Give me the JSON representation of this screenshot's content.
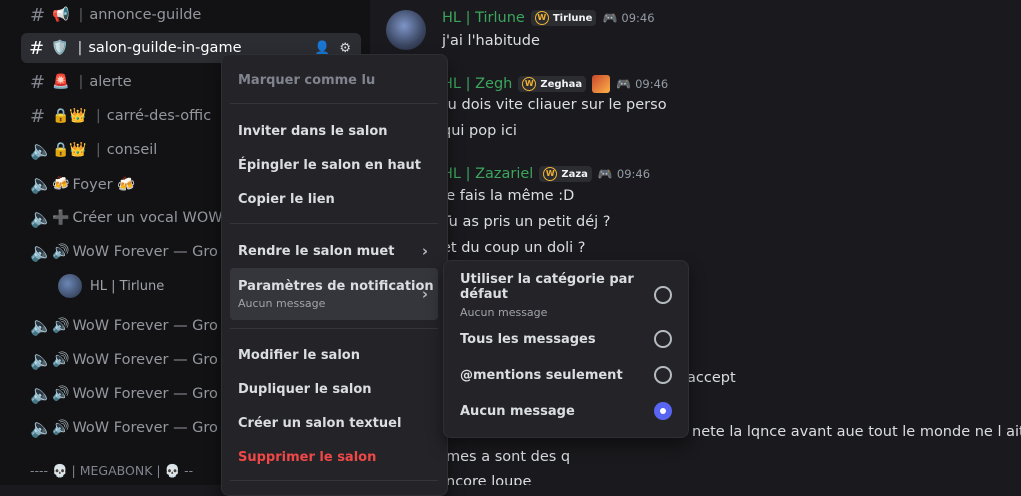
{
  "sidebar": {
    "channels": [
      {
        "type": "text",
        "emoji": "📢",
        "name": "annonce-guilde"
      },
      {
        "type": "text",
        "emoji": "🛡️",
        "name": "salon-guilde-in-game",
        "active": true
      },
      {
        "type": "text",
        "emoji": "🚨",
        "name": "alerte"
      },
      {
        "type": "text",
        "emoji": "🔒👑",
        "name": "carré-des-offic"
      },
      {
        "type": "voice",
        "emoji": "🔒👑",
        "name": "conseil"
      },
      {
        "type": "voice",
        "emoji": "🍻",
        "name": "Foyer 🍻"
      },
      {
        "type": "voice",
        "emoji": "➕",
        "name": "Créer un vocal WOW"
      },
      {
        "type": "voice",
        "emoji": "🔊",
        "name": "WoW Forever — Gro"
      },
      {
        "type": "voice",
        "emoji": "🔊",
        "name": "WoW Forever — Gro"
      },
      {
        "type": "voice",
        "emoji": "🔊",
        "name": "WoW Forever — Gro"
      },
      {
        "type": "voice",
        "emoji": "🔊",
        "name": "WoW Forever — Gro"
      },
      {
        "type": "voice",
        "emoji": "🔊",
        "name": "WoW Forever — Gro"
      }
    ],
    "voice_user": "HL | Tirlune",
    "bottom_label": "---- 💀 | MEGABONK | 💀 --"
  },
  "chat": {
    "messages": [
      {
        "user": "HL | Tirlune",
        "tag": "Tirlune",
        "time": "09:46",
        "lines": [
          "j'ai l'habitude"
        ]
      },
      {
        "user": "HL | Zegh",
        "tag": "Zeghaa",
        "time": "09:46",
        "lines": [
          "tu dois vite cliauer sur le perso",
          "qui pop ici"
        ]
      },
      {
        "user": "HL | Zazariel",
        "tag": "Zaza",
        "time": "09:46",
        "lines": [
          "Je fais la même :D",
          "Tu as pris un petit déj ?",
          "et du coup un doli ?"
        ]
      }
    ],
    "partial_lines": [
      "accept",
      "nete la lqnce avant aue tout le monde ne l ait pris",
      "mes a sont des q",
      "ncore loupe"
    ]
  },
  "context_menu": {
    "mark_read": "Marquer comme lu",
    "invite": "Inviter dans le salon",
    "pin": "Épingler le salon en haut",
    "copy_link": "Copier le lien",
    "mute": "Rendre le salon muet",
    "notif_settings": "Paramètres de notification",
    "notif_current": "Aucun message",
    "edit": "Modifier le salon",
    "duplicate": "Dupliquer le salon",
    "create_text": "Créer un salon textuel",
    "delete": "Supprimer le salon"
  },
  "notification_submenu": {
    "options": [
      {
        "label": "Utiliser la catégorie par défaut",
        "sub": "Aucun message",
        "selected": false
      },
      {
        "label": "Tous les messages",
        "selected": false
      },
      {
        "label": "@mentions seulement",
        "selected": false
      },
      {
        "label": "Aucun message",
        "selected": true
      }
    ]
  },
  "colors": {
    "accent": "#5865f2",
    "username": "#3ba55c",
    "danger": "#f04747"
  }
}
